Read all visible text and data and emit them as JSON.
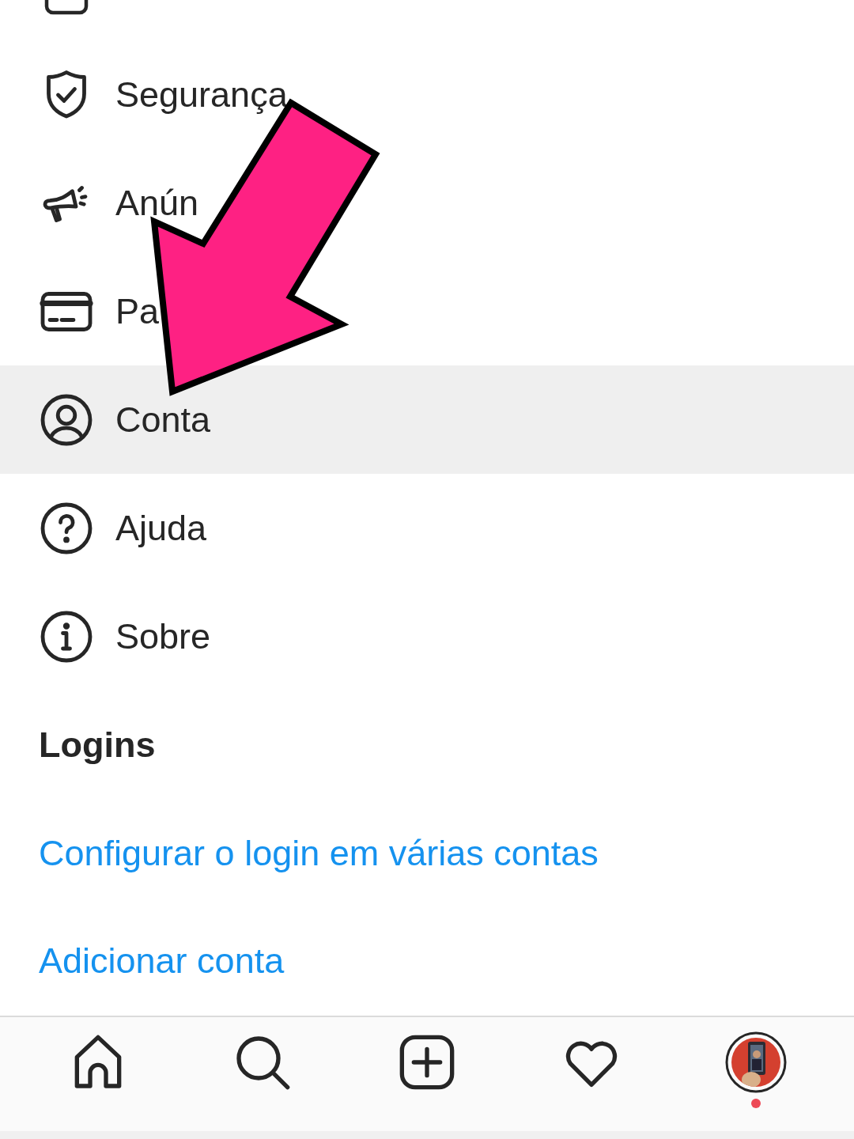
{
  "menu_items": [
    {
      "kind": "shield",
      "label": "Segurança",
      "selected": false
    },
    {
      "kind": "megaphone",
      "label": "Anún",
      "selected": false
    },
    {
      "kind": "card",
      "label": "Pa",
      "selected": false
    },
    {
      "kind": "person",
      "label": "Conta",
      "selected": true
    },
    {
      "kind": "help",
      "label": "Ajuda",
      "selected": false
    },
    {
      "kind": "info",
      "label": "Sobre",
      "selected": false
    }
  ],
  "logins": {
    "heading": "Logins",
    "links": [
      "Configurar o login em várias contas",
      "Adicionar conta"
    ]
  },
  "bottom_nav": [
    {
      "kind": "home"
    },
    {
      "kind": "search"
    },
    {
      "kind": "add"
    },
    {
      "kind": "heart"
    },
    {
      "kind": "profile",
      "notification": true
    }
  ]
}
